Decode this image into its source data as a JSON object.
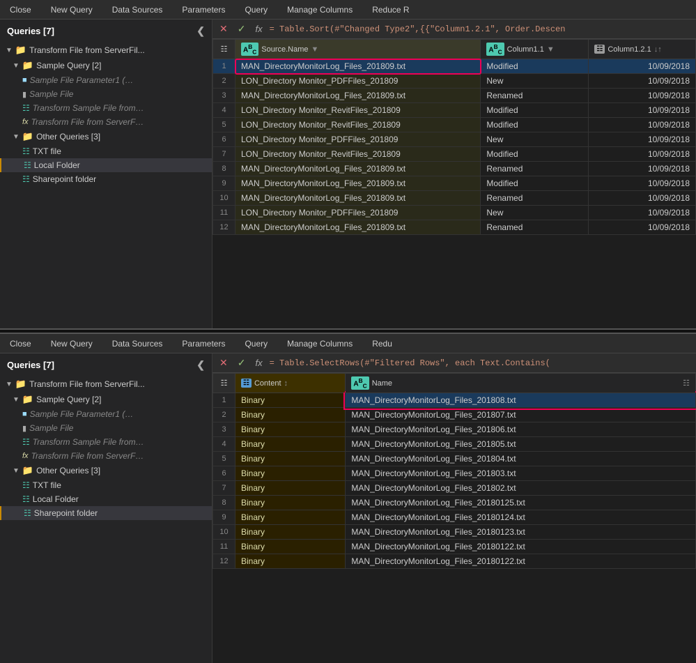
{
  "panels": [
    {
      "id": "top",
      "toolbar": {
        "items": [
          "Close",
          "New Query",
          "Data Sources",
          "Parameters",
          "Query",
          "Manage Columns",
          "Reduce R"
        ]
      },
      "formula": "= Table.Sort(#\"Changed Type2\",{{\"Column1.2.1\", Order.Descen",
      "sidebar": {
        "title": "Queries [7]",
        "groups": [
          {
            "label": "Transform File from ServerFil...",
            "type": "folder",
            "items": [
              {
                "label": "Sample Query [2]",
                "type": "folder",
                "items": [
                  {
                    "label": "Sample File Parameter1 (…",
                    "type": "param",
                    "indent": 3
                  },
                  {
                    "label": "Sample File",
                    "type": "file",
                    "indent": 3
                  },
                  {
                    "label": "Transform Sample File from…",
                    "type": "table",
                    "indent": 3
                  },
                  {
                    "label": "Transform File from ServerF…",
                    "type": "func",
                    "indent": 3
                  }
                ]
              },
              {
                "label": "Other Queries [3]",
                "type": "folder",
                "items": [
                  {
                    "label": "TXT file",
                    "type": "table",
                    "indent": 2
                  },
                  {
                    "label": "Local Folder",
                    "type": "table",
                    "indent": 2,
                    "active": true
                  },
                  {
                    "label": "Sharepoint folder",
                    "type": "table",
                    "indent": 2
                  }
                ]
              }
            ]
          }
        ]
      },
      "columns": [
        {
          "name": "Source.Name",
          "type": "ABC",
          "highlight": true
        },
        {
          "name": "Column1.1",
          "type": "ABC"
        },
        {
          "name": "Column1.2.1",
          "type": "123"
        }
      ],
      "rows": [
        {
          "num": 1,
          "c1": "MAN_DirectoryMonitorLog_Files_201809.txt",
          "c2": "Modified",
          "c3": "10/09/2018",
          "selected": true
        },
        {
          "num": 2,
          "c1": "LON_Directory Monitor_PDFFiles_201809",
          "c2": "New",
          "c3": "10/09/2018"
        },
        {
          "num": 3,
          "c1": "MAN_DirectoryMonitorLog_Files_201809.txt",
          "c2": "Renamed",
          "c3": "10/09/2018"
        },
        {
          "num": 4,
          "c1": "LON_Directory Monitor_RevitFiles_201809",
          "c2": "Modified",
          "c3": "10/09/2018"
        },
        {
          "num": 5,
          "c1": "LON_Directory Monitor_RevitFiles_201809",
          "c2": "Modified",
          "c3": "10/09/2018"
        },
        {
          "num": 6,
          "c1": "LON_Directory Monitor_PDFFiles_201809",
          "c2": "New",
          "c3": "10/09/2018"
        },
        {
          "num": 7,
          "c1": "LON_Directory Monitor_RevitFiles_201809",
          "c2": "Modified",
          "c3": "10/09/2018"
        },
        {
          "num": 8,
          "c1": "MAN_DirectoryMonitorLog_Files_201809.txt",
          "c2": "Renamed",
          "c3": "10/09/2018"
        },
        {
          "num": 9,
          "c1": "MAN_DirectoryMonitorLog_Files_201809.txt",
          "c2": "Modified",
          "c3": "10/09/2018"
        },
        {
          "num": 10,
          "c1": "MAN_DirectoryMonitorLog_Files_201809.txt",
          "c2": "Renamed",
          "c3": "10/09/2018"
        },
        {
          "num": 11,
          "c1": "LON_Directory Monitor_PDFFiles_201809",
          "c2": "New",
          "c3": "10/09/2018"
        },
        {
          "num": 12,
          "c1": "MAN_DirectoryMonitorLog_Files_201809.txt",
          "c2": "Renamed",
          "c3": "10/09/2018"
        }
      ]
    },
    {
      "id": "bottom",
      "toolbar": {
        "items": [
          "Close",
          "New Query",
          "Data Sources",
          "Parameters",
          "Query",
          "Manage Columns",
          "Redu"
        ]
      },
      "formula": "= Table.SelectRows(#\"Filtered Rows\", each Text.Contains(",
      "sidebar": {
        "title": "Queries [7]",
        "groups": [
          {
            "label": "Transform File from ServerFil...",
            "type": "folder",
            "items": [
              {
                "label": "Sample Query [2]",
                "type": "folder",
                "items": [
                  {
                    "label": "Sample File Parameter1 (…",
                    "type": "param",
                    "indent": 3
                  },
                  {
                    "label": "Sample File",
                    "type": "file",
                    "indent": 3
                  },
                  {
                    "label": "Transform Sample File from…",
                    "type": "table",
                    "indent": 3
                  },
                  {
                    "label": "Transform File from ServerF…",
                    "type": "func",
                    "indent": 3
                  }
                ]
              },
              {
                "label": "Other Queries [3]",
                "type": "folder",
                "items": [
                  {
                    "label": "TXT file",
                    "type": "table",
                    "indent": 2
                  },
                  {
                    "label": "Local Folder",
                    "type": "table",
                    "indent": 2
                  },
                  {
                    "label": "Sharepoint folder",
                    "type": "table",
                    "indent": 2,
                    "active": true
                  }
                ]
              }
            ]
          }
        ]
      },
      "columns": [
        {
          "name": "Content",
          "type": "table",
          "highlight": true
        },
        {
          "name": "Name",
          "type": "ABC"
        }
      ],
      "rows": [
        {
          "num": 1,
          "c1": "Binary",
          "c2": "MAN_DirectoryMonitorLog_Files_201808.txt",
          "selected": true
        },
        {
          "num": 2,
          "c1": "Binary",
          "c2": "MAN_DirectoryMonitorLog_Files_201807.txt"
        },
        {
          "num": 3,
          "c1": "Binary",
          "c2": "MAN_DirectoryMonitorLog_Files_201806.txt"
        },
        {
          "num": 4,
          "c1": "Binary",
          "c2": "MAN_DirectoryMonitorLog_Files_201805.txt"
        },
        {
          "num": 5,
          "c1": "Binary",
          "c2": "MAN_DirectoryMonitorLog_Files_201804.txt"
        },
        {
          "num": 6,
          "c1": "Binary",
          "c2": "MAN_DirectoryMonitorLog_Files_201803.txt"
        },
        {
          "num": 7,
          "c1": "Binary",
          "c2": "MAN_DirectoryMonitorLog_Files_201802.txt"
        },
        {
          "num": 8,
          "c1": "Binary",
          "c2": "MAN_DirectoryMonitorLog_Files_20180125.txt"
        },
        {
          "num": 9,
          "c1": "Binary",
          "c2": "MAN_DirectoryMonitorLog_Files_20180124.txt"
        },
        {
          "num": 10,
          "c1": "Binary",
          "c2": "MAN_DirectoryMonitorLog_Files_20180123.txt"
        },
        {
          "num": 11,
          "c1": "Binary",
          "c2": "MAN_DirectoryMonitorLog_Files_20180122.txt"
        },
        {
          "num": 12,
          "c1": "Binary",
          "c2": "MAN_DirectoryMonitorLog_Files_20180122.txt"
        }
      ]
    }
  ]
}
